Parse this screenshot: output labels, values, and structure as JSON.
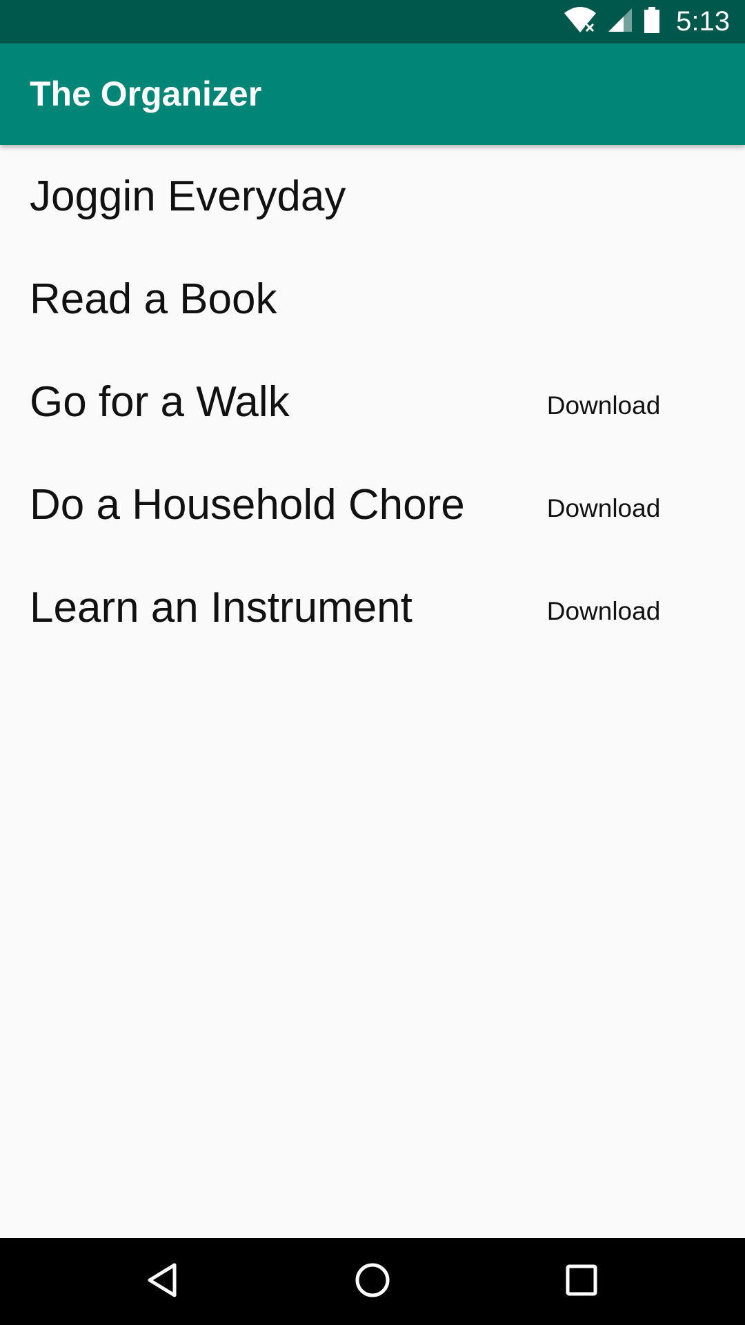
{
  "status_bar": {
    "time": "5:13",
    "icons": [
      "wifi-icon",
      "signal-icon",
      "battery-icon"
    ],
    "color": "#00574b"
  },
  "app_bar": {
    "title": "The Organizer",
    "color": "#008577"
  },
  "tasks": [
    {
      "title": "Joggin Everyday",
      "action": ""
    },
    {
      "title": "Read a Book",
      "action": ""
    },
    {
      "title": "Go for a Walk",
      "action": "Download"
    },
    {
      "title": "Do a Household Chore",
      "action": "Download"
    },
    {
      "title": "Learn an Instrument",
      "action": "Download"
    }
  ],
  "nav_bar": {
    "buttons": [
      "back-icon",
      "home-icon",
      "recents-icon"
    ]
  }
}
